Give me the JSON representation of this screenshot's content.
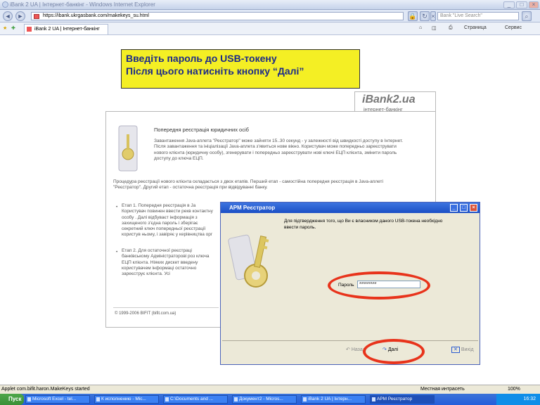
{
  "window": {
    "title": "iBank 2 UA | Інтернет-банкінг - Windows Internet Explorer"
  },
  "address": {
    "url": "https://ibank.ukrgasbank.com/makekeys_su.html",
    "search_placeholder": "Bank \"Live Search\""
  },
  "tab": {
    "label": "iBank 2 UA | Інтернет-банкінг"
  },
  "commands": {
    "page": "Страница",
    "tools": "Сервис"
  },
  "callout": {
    "line1": "Введіть пароль до USB-токену",
    "line2": "Після цього натисніть кнопку “Далі”"
  },
  "brand": {
    "name": "iBank2.ua",
    "sub": "інтернет-банкінг"
  },
  "content": {
    "heading": "Попередня реєстрація юридичних осіб",
    "intro": "Завантаження Java-аплета \"Реєстратор\" може зайняти 15..30 секунд - у залежності від швидкості доступу в Інтернет. Після завантаження та ініціалізації Java-аплета з'явиться нове вікно. Користувач може попередньо зареєструвати нового клієнта (юридичну особу), згенерувати і попередньо зареєструвати нові ключі ЕЦП клієнта, змінити пароль доступу до ключа ЕЦП.",
    "procedure": "Процедура реєстрації нового клієнта складається з двох етапів. Перший етап - самостійна попередня реєстрація в Java-аплеті \"Реєстратор\". Другий етап - остаточна реєстрація при відвідуванні банку.",
    "stage1": "Етап 1. Попередня реєстрація в Ja Користувач повинен ввести рекв контактну особу . Далі відбуваєт інформація з захищеного з'єдна пароль і зберігає секретний ключ попередньої реєстрації користув ньому, і завіряє у керівництва орг",
    "stage2": "Етап 2. Для остаточної реєстраці банківському Адміністраторові роз ключа ЕЦП клієнта. Ніяких дискет введену користувачем інформаці остаточно зареєструє клієнта. Усі",
    "footer": "© 1999-2006 BIFIT (bifit.com.ua)"
  },
  "dialog": {
    "title": "АРМ Реєстратор",
    "message": "Для підтвердження того, що Ви є власником даного USB-токена необхідно ввести пароль.",
    "password_label": "Пароль",
    "password_value": "*********",
    "back": "Назад",
    "next": "Далі",
    "exit": "Вихід"
  },
  "status": {
    "left": "Applet com.bifit.haron.MakeKeys started",
    "zone": "Местная интрасеть",
    "zoom": "100%"
  },
  "taskbar": {
    "start": "Пуск",
    "tasks": [
      "Microsoft Excel - tel...",
      "К исполнению - Mic...",
      "C:\\Documents and ...",
      "Документ2 - Micros...",
      "iBank 2 UA | Інтерн...",
      "АРМ Реєстратор"
    ],
    "clock": "16:32"
  }
}
